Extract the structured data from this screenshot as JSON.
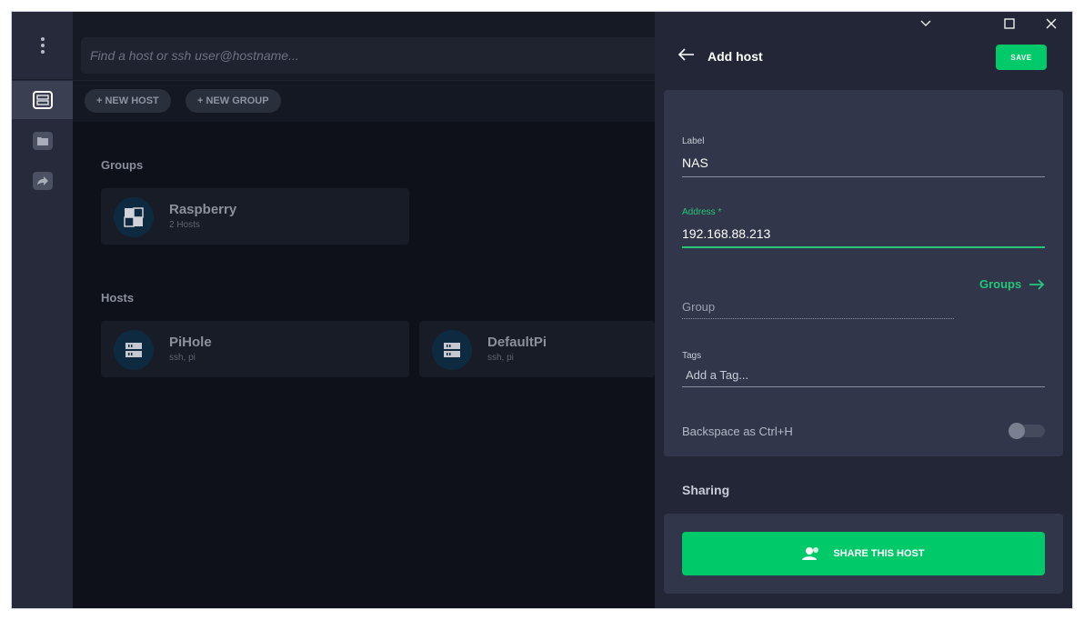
{
  "search": {
    "placeholder": "Find a host or ssh user@hostname..."
  },
  "toolbar": {
    "new_host": "+ NEW HOST",
    "new_group": "+ NEW GROUP"
  },
  "groups": {
    "title": "Groups",
    "items": [
      {
        "name": "Raspberry",
        "sub": "2 Hosts"
      }
    ]
  },
  "hosts": {
    "title": "Hosts",
    "items": [
      {
        "name": "PiHole",
        "sub": "ssh, pi"
      },
      {
        "name": "DefaultPi",
        "sub": "ssh, pi"
      }
    ]
  },
  "panel": {
    "title": "Add host",
    "save": "SAVE",
    "label_label": "Label",
    "label_value": "NAS",
    "address_label": "Address *",
    "address_value": "192.168.88.213",
    "group_placeholder": "Group",
    "groups_link": "Groups",
    "tags_label": "Tags",
    "tags_placeholder": "Add a Tag...",
    "backspace_label": "Backspace as Ctrl+H",
    "backspace_enabled": false,
    "sharing_title": "Sharing",
    "share_button": "SHARE THIS HOST"
  },
  "colors": {
    "accent": "#00c96a",
    "panel_bg": "#222636",
    "card_bg": "#31364a"
  },
  "icons": [
    "menu-dots-icon",
    "hosts-icon",
    "folder-icon",
    "forward-icon",
    "server-icon",
    "group-icon",
    "back-arrow-icon",
    "arrow-right-icon",
    "users-icon",
    "minimize-icon",
    "maximize-icon",
    "close-icon"
  ]
}
